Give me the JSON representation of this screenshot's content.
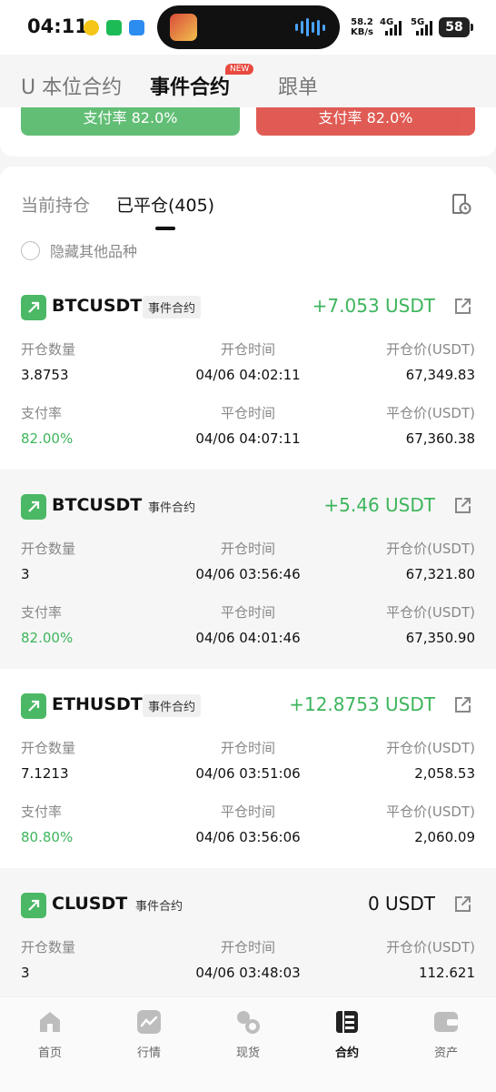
{
  "status_bar": {
    "time": "04:11",
    "speed_value": "58.2",
    "speed_unit": "KB/s",
    "net1": "4G",
    "net2": "5G",
    "battery": "58"
  },
  "top_tabs": [
    {
      "label": "U 本位合约",
      "active": false
    },
    {
      "label": "事件合约",
      "active": true,
      "badge": "NEW"
    },
    {
      "label": "跟单",
      "active": false
    }
  ],
  "pay_rate": {
    "up_label": "支付率 82.0%",
    "down_label": "支付率 82.0%",
    "up_color": "#55b96a",
    "down_color": "#de4e46"
  },
  "sub_tabs": [
    {
      "label": "当前持仓",
      "active": false
    },
    {
      "label": "已平仓(405)",
      "active": true
    }
  ],
  "hide_other": "隐藏其他品种",
  "labels": {
    "quantity": "开仓数量",
    "open_time": "开仓时间",
    "open_price": "开仓价(USDT)",
    "pay_rate": "支付率",
    "close_time": "平仓时间",
    "close_price": "平仓价(USDT)"
  },
  "positions": [
    {
      "symbol": "BTCUSDT",
      "tag": "事件合约",
      "pnl": "+7.053 USDT",
      "quantity": "3.8753",
      "open_time": "04/06 04:02:11",
      "open_price": "67,349.83",
      "pay_rate": "82.00%",
      "close_time": "04/06 04:07:11",
      "close_price": "67,360.38"
    },
    {
      "symbol": "BTCUSDT",
      "tag": "事件合约",
      "pnl": "+5.46 USDT",
      "quantity": "3",
      "open_time": "04/06 03:56:46",
      "open_price": "67,321.80",
      "pay_rate": "82.00%",
      "close_time": "04/06 04:01:46",
      "close_price": "67,350.90"
    },
    {
      "symbol": "ETHUSDT",
      "tag": "事件合约",
      "pnl": "+12.8753 USDT",
      "quantity": "7.1213",
      "open_time": "04/06 03:51:06",
      "open_price": "2,058.53",
      "pay_rate": "80.80%",
      "close_time": "04/06 03:56:06",
      "close_price": "2,060.09"
    },
    {
      "symbol": "CLUSDT",
      "tag": "事件合约",
      "pnl": "0 USDT",
      "quantity": "3",
      "open_time": "04/06 03:48:03",
      "open_price": "112.621"
    }
  ],
  "bottom_nav": [
    {
      "label": "首页",
      "icon": "home-icon",
      "active": false
    },
    {
      "label": "行情",
      "icon": "market-icon",
      "active": false
    },
    {
      "label": "现货",
      "icon": "spot-icon",
      "active": false
    },
    {
      "label": "合约",
      "icon": "contract-icon",
      "active": true
    },
    {
      "label": "资产",
      "icon": "wallet-icon",
      "active": false
    }
  ],
  "colors": {
    "profit_green": "#3db55c",
    "loss_red": "#de4e46",
    "badge_red": "#e84a3f"
  }
}
